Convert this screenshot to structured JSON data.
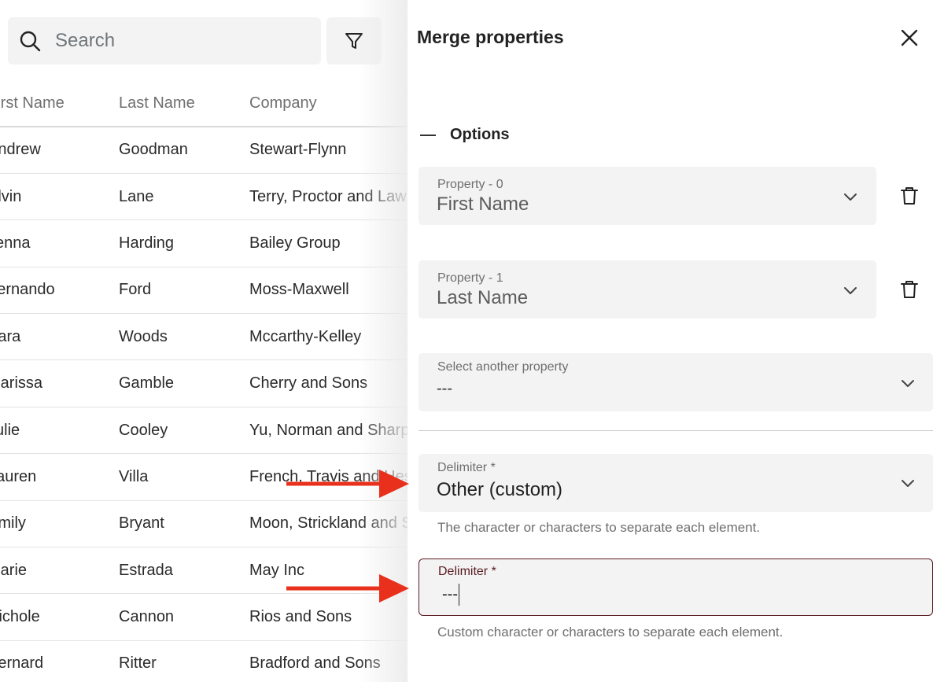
{
  "search": {
    "placeholder": "Search"
  },
  "table": {
    "columns": [
      "First Name",
      "Last Name",
      "Company"
    ],
    "rows": [
      [
        "Andrew",
        "Goodman",
        "Stewart-Flynn"
      ],
      [
        "Alvin",
        "Lane",
        "Terry, Proctor and Lawrence"
      ],
      [
        "Jenna",
        "Harding",
        "Bailey Group"
      ],
      [
        "Fernando",
        "Ford",
        "Moss-Maxwell"
      ],
      [
        "Kara",
        "Woods",
        "Mccarthy-Kelley"
      ],
      [
        "Marissa",
        "Gamble",
        "Cherry and Sons"
      ],
      [
        "Julie",
        "Cooley",
        "Yu, Norman and Sharp"
      ],
      [
        "Lauren",
        "Villa",
        "French, Travis and Hess"
      ],
      [
        "Emily",
        "Bryant",
        "Moon, Strickland and Sons"
      ],
      [
        "Marie",
        "Estrada",
        "May Inc"
      ],
      [
        "Nichole",
        "Cannon",
        "Rios and Sons"
      ],
      [
        "Bernard",
        "Ritter",
        "Bradford and Sons"
      ]
    ]
  },
  "panel": {
    "title": "Merge properties",
    "section_label": "Options",
    "property0": {
      "label": "Property - 0",
      "value": "First Name"
    },
    "property1": {
      "label": "Property - 1",
      "value": "Last Name"
    },
    "another": {
      "label": "Select another property",
      "value": "---"
    },
    "delimiter_select": {
      "label": "Delimiter *",
      "value": "Other (custom)",
      "helper": "The character or characters to separate each element."
    },
    "delimiter_custom": {
      "label": "Delimiter *",
      "value": "---",
      "helper": "Custom character or characters to separate each element."
    }
  },
  "colors": {
    "accent": "#5b1a22",
    "annotation_arrow": "#e8301c",
    "field_bg": "#f2f3f2"
  },
  "icons": [
    "search-icon",
    "filter-icon",
    "close-icon",
    "chevron-down-icon",
    "trash-icon",
    "arrow-annotation-icon"
  ]
}
